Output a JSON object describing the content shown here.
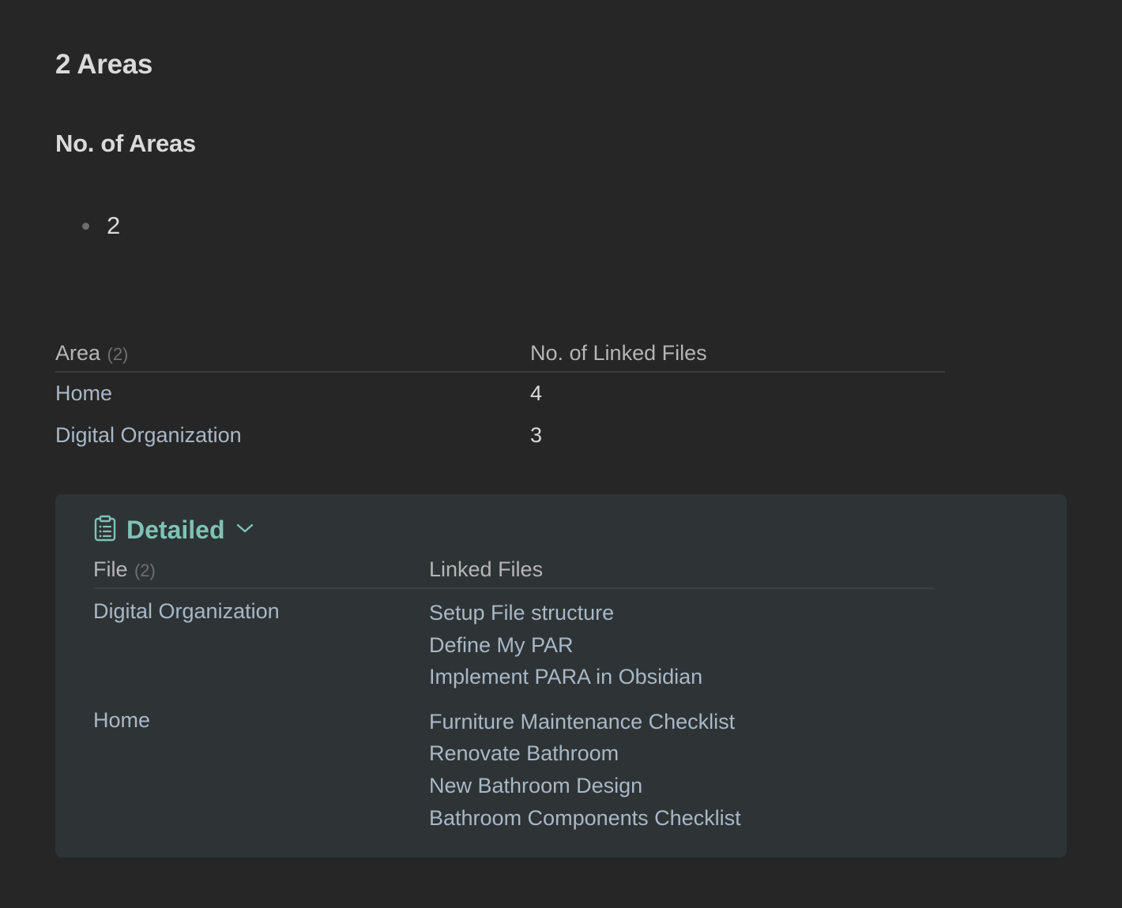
{
  "heading": "2 Areas",
  "subheading": "No. of Areas",
  "bullet_value": "2",
  "summary_table": {
    "headers": {
      "area_label": "Area",
      "area_count": "(2)",
      "linked_label": "No. of Linked Files"
    },
    "rows": [
      {
        "area": "Home",
        "count": "4"
      },
      {
        "area": "Digital Organization",
        "count": "3"
      }
    ]
  },
  "detailed": {
    "title": "Detailed",
    "icon": "clipboard-list-icon",
    "accent": "#7fc3b5",
    "headers": {
      "file_label": "File",
      "file_count": "(2)",
      "linked_label": "Linked Files"
    },
    "rows": [
      {
        "file": "Digital Organization",
        "links": [
          "Setup File structure",
          "Define My PAR",
          "Implement PARA in Obsidian"
        ]
      },
      {
        "file": "Home",
        "links": [
          "Furniture Maintenance Checklist",
          "Renovate Bathroom",
          "New Bathroom Design",
          "Bathroom Components Checklist"
        ]
      }
    ]
  }
}
